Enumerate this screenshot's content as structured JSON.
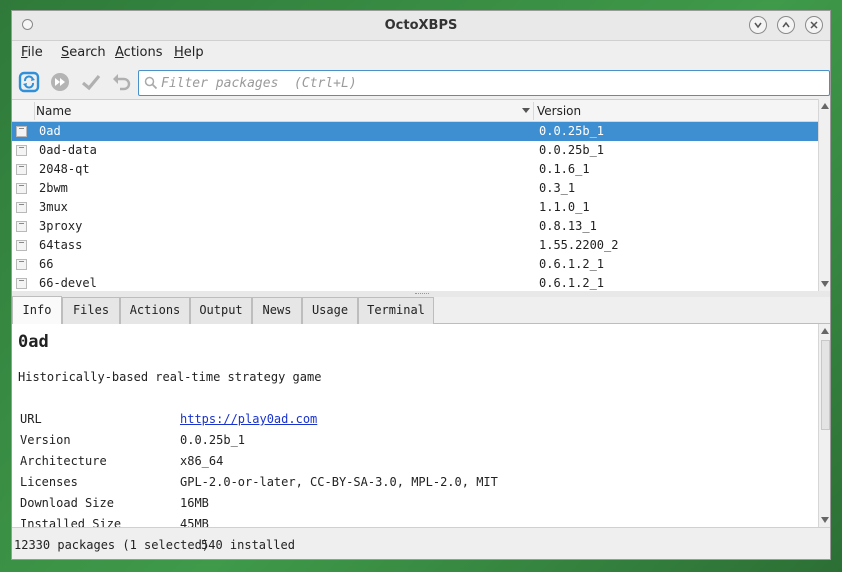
{
  "window": {
    "title": "OctoXBPS"
  },
  "menu": {
    "file": {
      "first": "F",
      "rest": "ile"
    },
    "search": {
      "first": "S",
      "rest": "earch"
    },
    "actions": {
      "first": "A",
      "rest": "ctions"
    },
    "help": {
      "first": "H",
      "rest": "elp"
    }
  },
  "toolbar": {
    "icons": [
      "sync-icon",
      "apply-all-icon",
      "commit-icon",
      "rollback-icon"
    ],
    "accent": "#2f8fd8"
  },
  "search": {
    "placeholder": "Filter packages  (Ctrl+L)",
    "value": ""
  },
  "list": {
    "headers": {
      "name": "Name",
      "version": "Version"
    },
    "rows": [
      {
        "name": "0ad",
        "version": "0.0.25b_1",
        "selected": true
      },
      {
        "name": "0ad-data",
        "version": "0.0.25b_1"
      },
      {
        "name": "2048-qt",
        "version": "0.1.6_1"
      },
      {
        "name": "2bwm",
        "version": "0.3_1"
      },
      {
        "name": "3mux",
        "version": "1.1.0_1"
      },
      {
        "name": "3proxy",
        "version": "0.8.13_1"
      },
      {
        "name": "64tass",
        "version": "1.55.2200_2"
      },
      {
        "name": "66",
        "version": "0.6.1.2_1"
      },
      {
        "name": "66-devel",
        "version": "0.6.1.2_1"
      }
    ],
    "selection_color": "#3d8fd1"
  },
  "tabs": [
    "Info",
    "Files",
    "Actions",
    "Output",
    "News",
    "Usage",
    "Terminal"
  ],
  "info": {
    "package": "0ad",
    "description": "Historically-based real-time strategy game",
    "fields": [
      {
        "key": "URL",
        "value": "https://play0ad.com",
        "link": true
      },
      {
        "key": "Version",
        "value": "0.0.25b_1"
      },
      {
        "key": "Architecture",
        "value": "x86_64"
      },
      {
        "key": "Licenses",
        "value": "GPL-2.0-or-later, CC-BY-SA-3.0, MPL-2.0, MIT"
      },
      {
        "key": "Download Size",
        "value": "16MB"
      },
      {
        "key": "Installed Size",
        "value": "45MB"
      }
    ]
  },
  "status": {
    "packages": "12330 packages (1 selected)",
    "installed": "540 installed"
  }
}
